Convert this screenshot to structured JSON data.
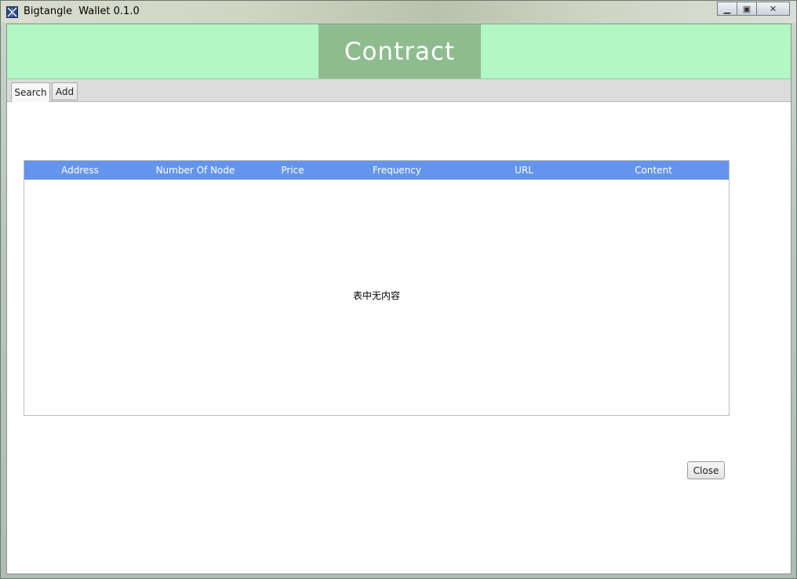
{
  "window": {
    "title": "Bigtangle  Wallet 0.1.0",
    "icon": "app-logo-icon",
    "controls": {
      "minimize_icon": "minimize-icon",
      "maximize_icon": "maximize-icon",
      "close_icon": "close-icon",
      "minimize_glyph": "▁",
      "maximize_glyph": "▣",
      "close_glyph": "✕"
    }
  },
  "header": {
    "title": "Contract",
    "band_color": "#b3f7c4",
    "title_box_color": "#8fbc8f"
  },
  "tabs": [
    {
      "label": "Search",
      "active": true
    },
    {
      "label": "Add",
      "active": false
    }
  ],
  "table": {
    "header_color": "#6495ed",
    "columns": [
      "Address",
      "Number Of Node",
      "Price",
      "Frequency",
      "URL",
      "Content"
    ],
    "rows": [],
    "empty_message": "表中无内容"
  },
  "footer": {
    "close_label": "Close"
  }
}
